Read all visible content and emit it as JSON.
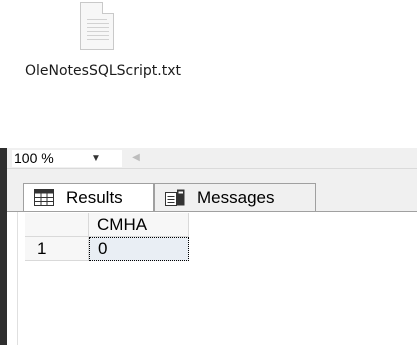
{
  "desktop": {
    "file_name": "OleNotesSQLScript.txt",
    "file_icon": "text-file-icon"
  },
  "toolbar": {
    "zoom_value": "100 %",
    "zoom_dropdown_icon": "chevron-down-icon",
    "scroll_icon": "scroll-left-icon"
  },
  "tabs": [
    {
      "label": "Results",
      "icon": "grid-icon",
      "active": true
    },
    {
      "label": "Messages",
      "icon": "messages-icon",
      "active": false
    }
  ],
  "results_grid": {
    "columns": [
      "CMHA"
    ],
    "rows": [
      {
        "row_number": "1",
        "cells": [
          "0"
        ]
      }
    ],
    "selected_cell_color": "#e9eef4"
  }
}
